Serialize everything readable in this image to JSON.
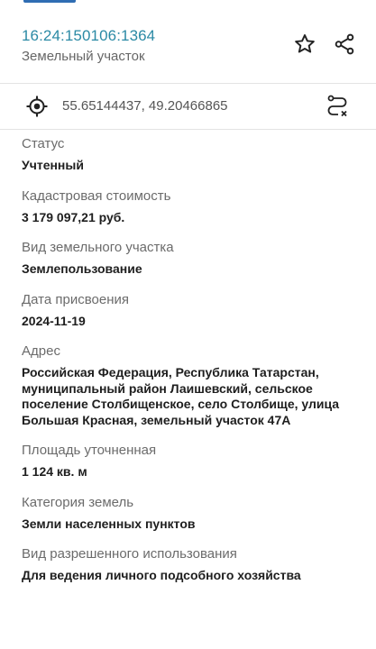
{
  "header": {
    "cadastral_number": "16:24:150106:1364",
    "subtitle": "Земельный участок"
  },
  "location": {
    "coordinates": "55.65144437, 49.20466865"
  },
  "icons": {
    "favorite": "star-icon",
    "share": "share-icon",
    "locate": "crosshair-target-icon",
    "route": "route-icon"
  },
  "fields": [
    {
      "label": "Статус",
      "value": "Учтенный"
    },
    {
      "label": "Кадастровая стоимость",
      "value": "3 179 097,21 руб."
    },
    {
      "label": "Вид земельного участка",
      "value": "Землепользование"
    },
    {
      "label": "Дата присвоения",
      "value": "2024-11-19"
    },
    {
      "label": "Адрес",
      "value": "Российская Федерация, Республика Татарстан, муниципальный район Лаишевский, сельское поселение Столбищенское, село Столбище, улица Большая Красная, земельный участок 47А"
    },
    {
      "label": "Площадь уточненная",
      "value": "1 124 кв. м"
    },
    {
      "label": "Категория земель",
      "value": "Земли населенных пунктов"
    },
    {
      "label": "Вид разрешенного использования",
      "value": "Для ведения личного подсобного хозяйства"
    }
  ],
  "colors": {
    "accent": "#2b8aa5",
    "top_bar": "#2f6db3",
    "label": "#6b6b6b",
    "value": "#1e1e1e",
    "divider": "#e3e3e3"
  }
}
